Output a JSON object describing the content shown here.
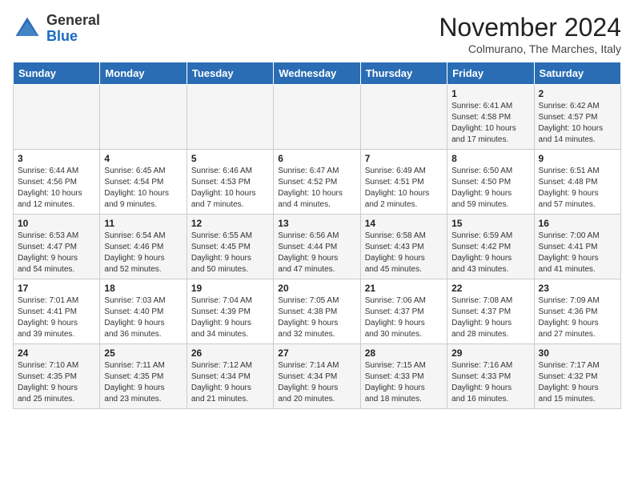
{
  "header": {
    "logo_general": "General",
    "logo_blue": "Blue",
    "month_title": "November 2024",
    "location": "Colmurano, The Marches, Italy"
  },
  "weekdays": [
    "Sunday",
    "Monday",
    "Tuesday",
    "Wednesday",
    "Thursday",
    "Friday",
    "Saturday"
  ],
  "weeks": [
    [
      {
        "day": "",
        "info": ""
      },
      {
        "day": "",
        "info": ""
      },
      {
        "day": "",
        "info": ""
      },
      {
        "day": "",
        "info": ""
      },
      {
        "day": "",
        "info": ""
      },
      {
        "day": "1",
        "info": "Sunrise: 6:41 AM\nSunset: 4:58 PM\nDaylight: 10 hours\nand 17 minutes."
      },
      {
        "day": "2",
        "info": "Sunrise: 6:42 AM\nSunset: 4:57 PM\nDaylight: 10 hours\nand 14 minutes."
      }
    ],
    [
      {
        "day": "3",
        "info": "Sunrise: 6:44 AM\nSunset: 4:56 PM\nDaylight: 10 hours\nand 12 minutes."
      },
      {
        "day": "4",
        "info": "Sunrise: 6:45 AM\nSunset: 4:54 PM\nDaylight: 10 hours\nand 9 minutes."
      },
      {
        "day": "5",
        "info": "Sunrise: 6:46 AM\nSunset: 4:53 PM\nDaylight: 10 hours\nand 7 minutes."
      },
      {
        "day": "6",
        "info": "Sunrise: 6:47 AM\nSunset: 4:52 PM\nDaylight: 10 hours\nand 4 minutes."
      },
      {
        "day": "7",
        "info": "Sunrise: 6:49 AM\nSunset: 4:51 PM\nDaylight: 10 hours\nand 2 minutes."
      },
      {
        "day": "8",
        "info": "Sunrise: 6:50 AM\nSunset: 4:50 PM\nDaylight: 9 hours\nand 59 minutes."
      },
      {
        "day": "9",
        "info": "Sunrise: 6:51 AM\nSunset: 4:48 PM\nDaylight: 9 hours\nand 57 minutes."
      }
    ],
    [
      {
        "day": "10",
        "info": "Sunrise: 6:53 AM\nSunset: 4:47 PM\nDaylight: 9 hours\nand 54 minutes."
      },
      {
        "day": "11",
        "info": "Sunrise: 6:54 AM\nSunset: 4:46 PM\nDaylight: 9 hours\nand 52 minutes."
      },
      {
        "day": "12",
        "info": "Sunrise: 6:55 AM\nSunset: 4:45 PM\nDaylight: 9 hours\nand 50 minutes."
      },
      {
        "day": "13",
        "info": "Sunrise: 6:56 AM\nSunset: 4:44 PM\nDaylight: 9 hours\nand 47 minutes."
      },
      {
        "day": "14",
        "info": "Sunrise: 6:58 AM\nSunset: 4:43 PM\nDaylight: 9 hours\nand 45 minutes."
      },
      {
        "day": "15",
        "info": "Sunrise: 6:59 AM\nSunset: 4:42 PM\nDaylight: 9 hours\nand 43 minutes."
      },
      {
        "day": "16",
        "info": "Sunrise: 7:00 AM\nSunset: 4:41 PM\nDaylight: 9 hours\nand 41 minutes."
      }
    ],
    [
      {
        "day": "17",
        "info": "Sunrise: 7:01 AM\nSunset: 4:41 PM\nDaylight: 9 hours\nand 39 minutes."
      },
      {
        "day": "18",
        "info": "Sunrise: 7:03 AM\nSunset: 4:40 PM\nDaylight: 9 hours\nand 36 minutes."
      },
      {
        "day": "19",
        "info": "Sunrise: 7:04 AM\nSunset: 4:39 PM\nDaylight: 9 hours\nand 34 minutes."
      },
      {
        "day": "20",
        "info": "Sunrise: 7:05 AM\nSunset: 4:38 PM\nDaylight: 9 hours\nand 32 minutes."
      },
      {
        "day": "21",
        "info": "Sunrise: 7:06 AM\nSunset: 4:37 PM\nDaylight: 9 hours\nand 30 minutes."
      },
      {
        "day": "22",
        "info": "Sunrise: 7:08 AM\nSunset: 4:37 PM\nDaylight: 9 hours\nand 28 minutes."
      },
      {
        "day": "23",
        "info": "Sunrise: 7:09 AM\nSunset: 4:36 PM\nDaylight: 9 hours\nand 27 minutes."
      }
    ],
    [
      {
        "day": "24",
        "info": "Sunrise: 7:10 AM\nSunset: 4:35 PM\nDaylight: 9 hours\nand 25 minutes."
      },
      {
        "day": "25",
        "info": "Sunrise: 7:11 AM\nSunset: 4:35 PM\nDaylight: 9 hours\nand 23 minutes."
      },
      {
        "day": "26",
        "info": "Sunrise: 7:12 AM\nSunset: 4:34 PM\nDaylight: 9 hours\nand 21 minutes."
      },
      {
        "day": "27",
        "info": "Sunrise: 7:14 AM\nSunset: 4:34 PM\nDaylight: 9 hours\nand 20 minutes."
      },
      {
        "day": "28",
        "info": "Sunrise: 7:15 AM\nSunset: 4:33 PM\nDaylight: 9 hours\nand 18 minutes."
      },
      {
        "day": "29",
        "info": "Sunrise: 7:16 AM\nSunset: 4:33 PM\nDaylight: 9 hours\nand 16 minutes."
      },
      {
        "day": "30",
        "info": "Sunrise: 7:17 AM\nSunset: 4:32 PM\nDaylight: 9 hours\nand 15 minutes."
      }
    ]
  ]
}
